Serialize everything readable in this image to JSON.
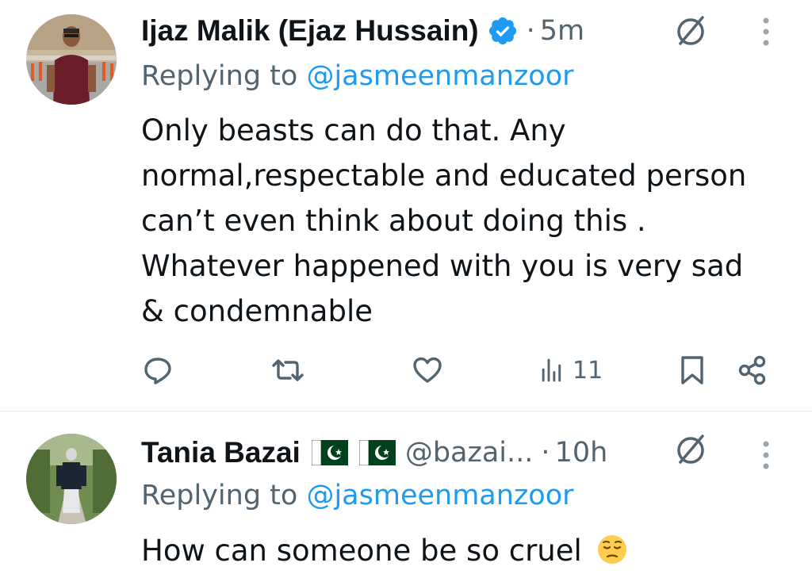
{
  "tweets": [
    {
      "author_name": "Ijaz Malik (Ejaz Hussain)",
      "verified": true,
      "separator": "·",
      "time": "5m",
      "reply_prefix": "Replying to ",
      "reply_mention": "@jasmeenmanzoor",
      "body_lines": [
        "Only beasts can do that. Any",
        "normal,respectable and educated person",
        "can’t even think about doing this .",
        "Whatever happened with you is very sad",
        "& condemnable"
      ],
      "views": "11"
    },
    {
      "author_name": "Tania Bazai",
      "handle": "@bazai...",
      "separator": "·",
      "time": "10h",
      "reply_prefix": "Replying to ",
      "reply_mention": "@jasmeenmanzoor",
      "body_text": "How can someone be so cruel",
      "body_emoji": "pensive-face-emoji"
    }
  ],
  "icons": {
    "reply": "reply-icon",
    "retweet": "retweet-icon",
    "like": "heart-icon",
    "views": "views-icon",
    "bookmark": "bookmark-icon",
    "share": "share-icon",
    "grok": "grok-icon",
    "more": "more-vertical-icon",
    "verified": "verified-badge-icon",
    "flag": "pakistan-flag-icon"
  },
  "colors": {
    "text": "#0f1419",
    "secondary": "#536471",
    "accent": "#1d9bf0",
    "divider": "#e6e9ec"
  }
}
